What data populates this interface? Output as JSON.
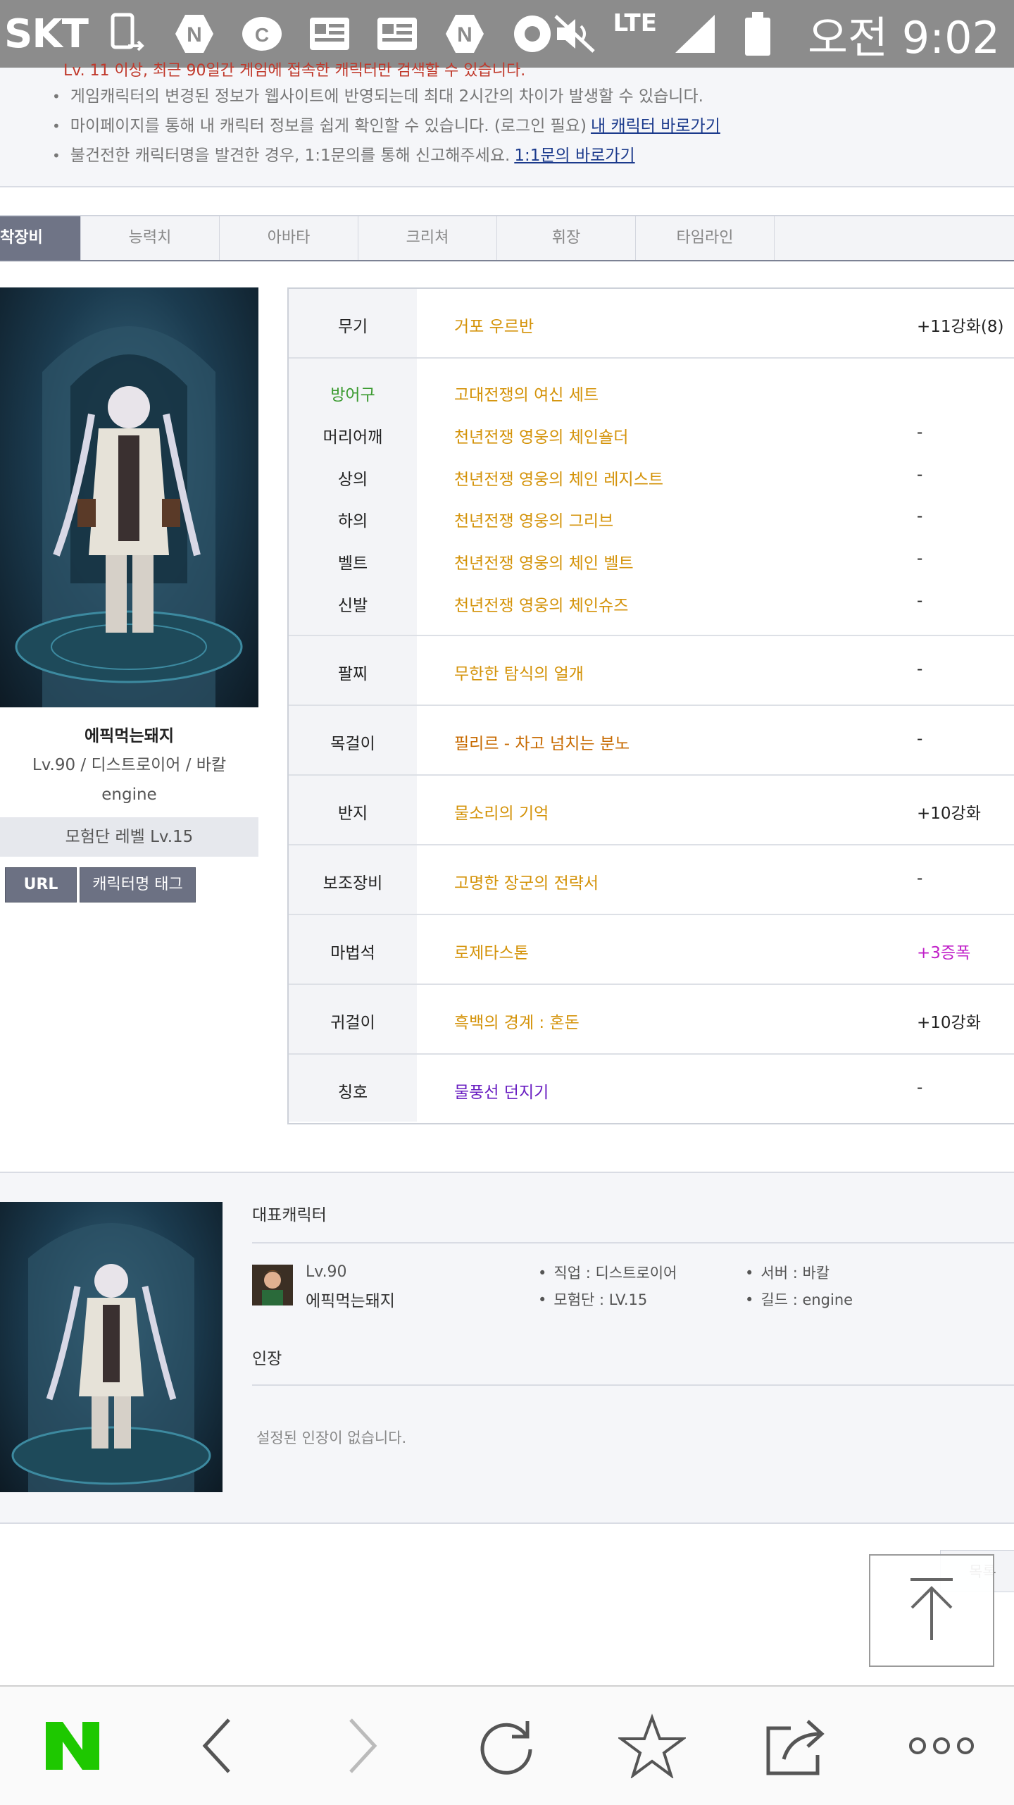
{
  "status_bar": {
    "carrier": "SKT",
    "network": "LTE",
    "time": "오전 9:02",
    "icons": [
      "phone-transfer-icon",
      "naver-n-icon",
      "c-icon",
      "news-icon",
      "news-icon",
      "naver-n-icon",
      "settings-badge-icon",
      "mute-icon",
      "signal-icon",
      "battery-icon"
    ]
  },
  "notice": {
    "cut_line": "Lv. 11 이상, 최근 90일간 게임에 접속한 캐릭터만 검색할 수 있습니다.",
    "items": [
      {
        "text": "게임캐릭터의 변경된 정보가 웹사이트에 반영되는데 최대 2시간의 차이가 발생할 수 있습니다.",
        "link": ""
      },
      {
        "text": "마이페이지를 통해 내 캐릭터 정보를 쉽게 확인할 수 있습니다. (로그인 필요)",
        "link": "내 캐릭터 바로가기"
      },
      {
        "text": "불건전한 캐릭터명을 발견한 경우, 1:1문의를 통해 신고해주세요.",
        "link": "1:1문의 바로가기"
      }
    ]
  },
  "tabs": [
    "착장비",
    "능력치",
    "아바타",
    "크리쳐",
    "휘장",
    "타임라인"
  ],
  "character": {
    "name": "에픽먹는돼지",
    "info": "Lv.90 / 디스트로이어 / 바칼",
    "guild": "engine",
    "adventure_level": "모험단 레벨 Lv.15",
    "url_button": "URL",
    "tag_button": "캐릭터명 태그"
  },
  "equipment": {
    "weapon": {
      "label": "무기",
      "item": "거포 우르반",
      "extra": "+11강화(8)"
    },
    "armor_title": "방어구",
    "armor_set": "고대전쟁의 여신 세트",
    "armor": [
      {
        "label": "머리어깨",
        "item": "천년전쟁 영웅의 체인숄더",
        "extra": "-"
      },
      {
        "label": "상의",
        "item": "천년전쟁 영웅의 체인 레지스트",
        "extra": "-"
      },
      {
        "label": "하의",
        "item": "천년전쟁 영웅의 그리브",
        "extra": "-"
      },
      {
        "label": "벨트",
        "item": "천년전쟁 영웅의 체인 벨트",
        "extra": "-"
      },
      {
        "label": "신발",
        "item": "천년전쟁 영웅의 체인슈즈",
        "extra": "-"
      }
    ],
    "others": [
      {
        "label": "팔찌",
        "item": "무한한 탐식의 얼개",
        "extra": "-"
      },
      {
        "label": "목걸이",
        "item": "필리르 - 차고 넘치는 분노",
        "extra": "-"
      },
      {
        "label": "반지",
        "item": "물소리의 기억",
        "extra": "+10강화"
      },
      {
        "label": "보조장비",
        "item": "고명한 장군의 전략서",
        "extra": "-"
      },
      {
        "label": "마법석",
        "item": "로제타스톤",
        "extra": "+3증폭"
      },
      {
        "label": "귀걸이",
        "item": "흑백의 경계 : 혼돈",
        "extra": "+10강화"
      },
      {
        "label": "칭호",
        "item": "물풍선 던지기",
        "extra": "-"
      }
    ]
  },
  "representative": {
    "title": "대표캐릭터",
    "level": "Lv.90",
    "name": "에픽먹는돼지",
    "job": "직업 : 디스트로이어",
    "adventure": "모험단 : LV.15",
    "server": "서버 : 바칼",
    "guild": "길드 : engine",
    "seal_title": "인장",
    "seal_empty": "설정된 인장이 없습니다."
  },
  "list_button": "목록",
  "colors": {
    "status_bar": "#8c8c8c",
    "unique_item": "#d4930a",
    "legendary_item": "#c76a00",
    "rare_item": "#6a1fc2",
    "armor_label": "#3a9a2f",
    "amplify": "#c01fc8",
    "naver_green": "#1ec800"
  }
}
